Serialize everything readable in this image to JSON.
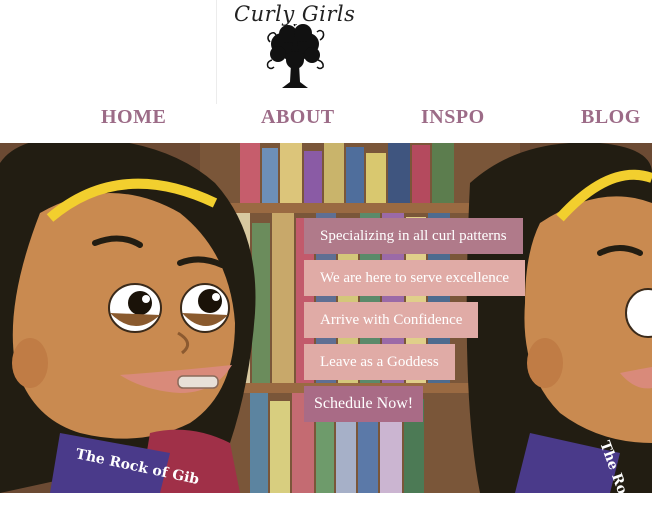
{
  "brand": {
    "logo_text": "Curly Girls"
  },
  "nav": {
    "items": [
      {
        "label": "HOME"
      },
      {
        "label": "ABOUT"
      },
      {
        "label": "INSPO"
      },
      {
        "label": "BLOG"
      }
    ]
  },
  "hero": {
    "taglines": [
      "Specializing in all curl patterns",
      "We are here to serve excellence",
      "Arrive with Confidence",
      "Leave as a Goddess"
    ],
    "cta_label": "Schedule Now!",
    "book_spine_text": "The Rock of Gib",
    "book_spine_text_short": "The Ro",
    "colors": {
      "tag_rose": "#b07a8a",
      "tag_blush": "#e0aba6",
      "cta": "#a96b86",
      "nav": "#9c6b87"
    }
  }
}
